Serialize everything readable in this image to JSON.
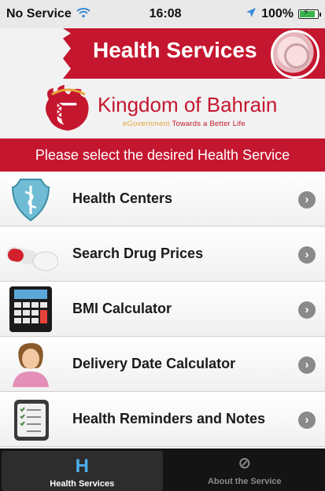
{
  "status_bar": {
    "carrier": "No Service",
    "time": "16:08",
    "battery": "100%"
  },
  "header": {
    "title": "Health Services"
  },
  "logo": {
    "name": "Kingdom of Bahrain",
    "tagline_prefix": "eGovernment",
    "tagline_suffix": "Towards a Better Life"
  },
  "prompt": "Please select the desired Health Service",
  "services": [
    {
      "label": "Health Centers",
      "icon": "shield-caduceus-icon"
    },
    {
      "label": "Search Drug Prices",
      "icon": "pills-icon"
    },
    {
      "label": "BMI Calculator",
      "icon": "calculator-icon"
    },
    {
      "label": "Delivery Date Calculator",
      "icon": "woman-icon"
    },
    {
      "label": "Health Reminders and Notes",
      "icon": "notepad-icon"
    }
  ],
  "tabbar": {
    "tabs": [
      {
        "label": "Health Services",
        "glyph": "H",
        "active": true
      },
      {
        "label": "About the Service",
        "glyph": "⊘",
        "active": false
      }
    ]
  },
  "colors": {
    "accent_red": "#c5162f",
    "tab_active_blue": "#4db0ea"
  }
}
